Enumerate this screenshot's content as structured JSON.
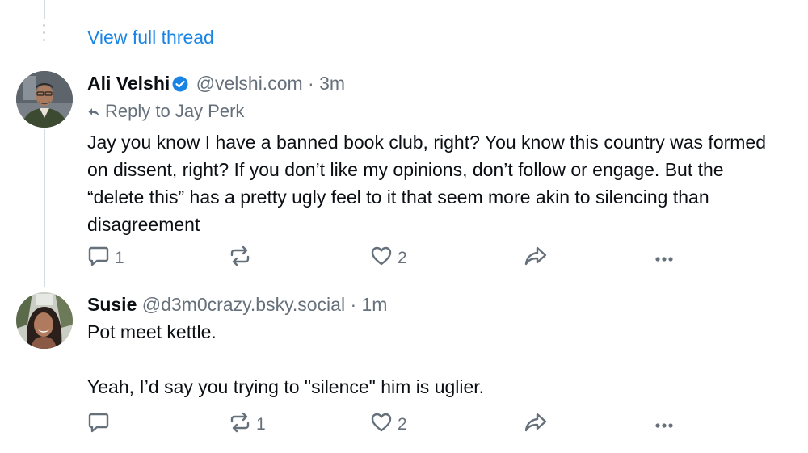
{
  "thread": {
    "view_full_thread": "View full thread"
  },
  "posts": [
    {
      "author_name": "Ali Velshi",
      "verified": true,
      "handle": "@velshi.com",
      "separator": "·",
      "time": "3m",
      "reply_to": "Reply to Jay Perk",
      "text_lines": [
        "Jay you know I have a banned book club, right? You know this country was formed on dissent, right? If you don’t like my opinions, don’t follow or engage. But the “delete this” has a pretty ugly feel to it that seem more akin to silencing than disagreement"
      ],
      "replies": "1",
      "reposts": "",
      "likes": "2"
    },
    {
      "author_name": "Susie",
      "verified": false,
      "handle": "@d3m0crazy.bsky.social",
      "separator": "·",
      "time": "1m",
      "text_lines": [
        "Pot meet kettle.",
        "Yeah, I’d say you trying to \"silence\" him is uglier."
      ],
      "replies": "",
      "reposts": "1",
      "likes": "2"
    }
  ],
  "icons": {
    "reply": "reply-icon",
    "repost": "repost-icon",
    "like": "heart-icon",
    "share": "share-icon",
    "more": "more-icon",
    "verified": "verified-badge-icon"
  },
  "colors": {
    "link": "#1a84e4",
    "muted": "#66707b",
    "text": "#0b0f14",
    "thread_line": "#d4dbe2"
  }
}
